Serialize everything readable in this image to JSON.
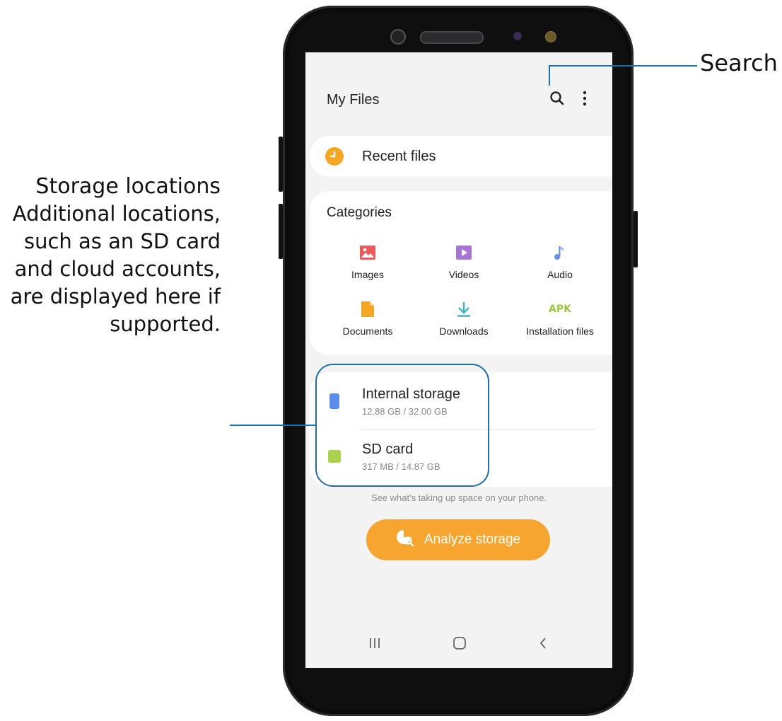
{
  "callouts": {
    "search_label": "Search",
    "storage_title": "Storage locations",
    "storage_body": "Additional locations, such as an SD card and cloud accounts, are displayed here if supported."
  },
  "app": {
    "title": "My Files"
  },
  "recent": {
    "label": "Recent files"
  },
  "categories": {
    "title": "Categories",
    "items": [
      {
        "label": "Images",
        "icon": "image-icon",
        "color": "#ee5a5a"
      },
      {
        "label": "Videos",
        "icon": "video-icon",
        "color": "#a874d6"
      },
      {
        "label": "Audio",
        "icon": "music-note-icon",
        "color": "#6b8fe8"
      },
      {
        "label": "Documents",
        "icon": "document-icon",
        "color": "#f5a623"
      },
      {
        "label": "Downloads",
        "icon": "download-icon",
        "color": "#3cb5c7"
      },
      {
        "label": "Installation files",
        "icon": "apk-icon",
        "icon_text": "APK",
        "color": "#98c93c"
      }
    ]
  },
  "storage": {
    "items": [
      {
        "name": "Internal storage",
        "size": "12.88 GB / 32.00 GB",
        "icon": "phone-storage-icon",
        "color": "#5b8def"
      },
      {
        "name": "SD card",
        "size": "317 MB / 14.87 GB",
        "icon": "sd-card-icon",
        "color": "#a9d14b"
      }
    ]
  },
  "analyze": {
    "hint": "See what's taking up space on your phone.",
    "button_label": "Analyze storage"
  },
  "colors": {
    "accent": "#f5a530",
    "callout_line": "#1f6fa8"
  }
}
